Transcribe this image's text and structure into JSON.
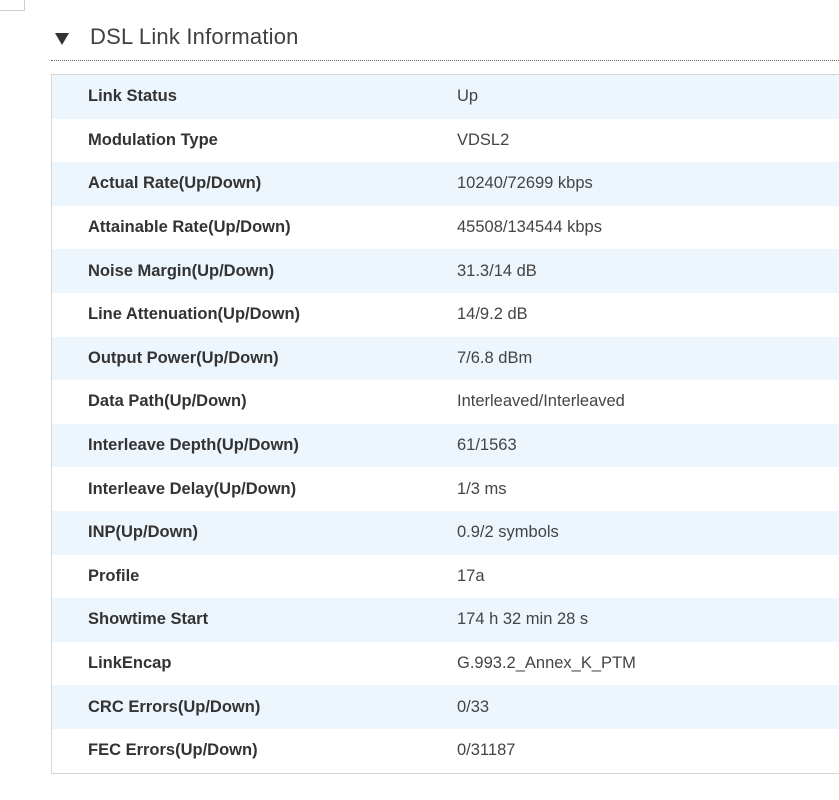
{
  "section": {
    "title": "DSL Link Information"
  },
  "rows": [
    {
      "label": "Link Status",
      "value": "Up"
    },
    {
      "label": "Modulation Type",
      "value": "VDSL2"
    },
    {
      "label": "Actual Rate(Up/Down)",
      "value": "10240/72699 kbps"
    },
    {
      "label": "Attainable Rate(Up/Down)",
      "value": "45508/134544 kbps"
    },
    {
      "label": "Noise Margin(Up/Down)",
      "value": "31.3/14 dB"
    },
    {
      "label": "Line Attenuation(Up/Down)",
      "value": "14/9.2 dB"
    },
    {
      "label": "Output Power(Up/Down)",
      "value": "7/6.8 dBm"
    },
    {
      "label": "Data Path(Up/Down)",
      "value": "Interleaved/Interleaved"
    },
    {
      "label": "Interleave Depth(Up/Down)",
      "value": "61/1563"
    },
    {
      "label": "Interleave Delay(Up/Down)",
      "value": "1/3 ms"
    },
    {
      "label": "INP(Up/Down)",
      "value": "0.9/2 symbols"
    },
    {
      "label": "Profile",
      "value": "17a"
    },
    {
      "label": "Showtime Start",
      "value": "174 h 32 min 28 s"
    },
    {
      "label": "LinkEncap",
      "value": "G.993.2_Annex_K_PTM"
    },
    {
      "label": "CRC Errors(Up/Down)",
      "value": "0/33"
    },
    {
      "label": "FEC Errors(Up/Down)",
      "value": "0/31187"
    }
  ]
}
